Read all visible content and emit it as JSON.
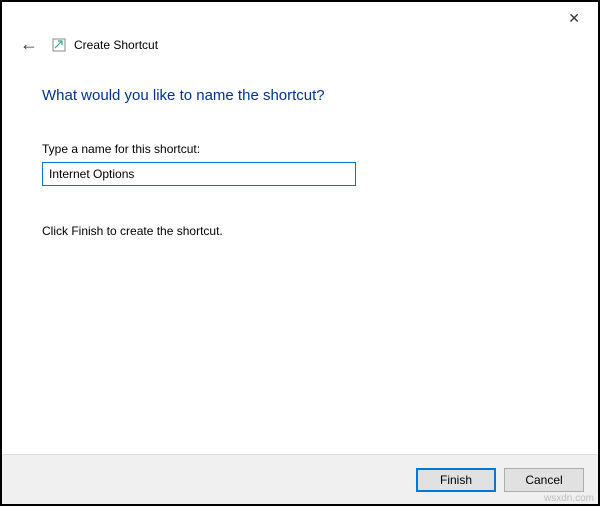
{
  "window": {
    "title": "Create Shortcut"
  },
  "wizard": {
    "heading": "What would you like to name the shortcut?",
    "field_label": "Type a name for this shortcut:",
    "name_value": "Internet Options",
    "instruction": "Click Finish to create the shortcut."
  },
  "buttons": {
    "finish": "Finish",
    "cancel": "Cancel"
  },
  "watermark": "wsxdn.com"
}
